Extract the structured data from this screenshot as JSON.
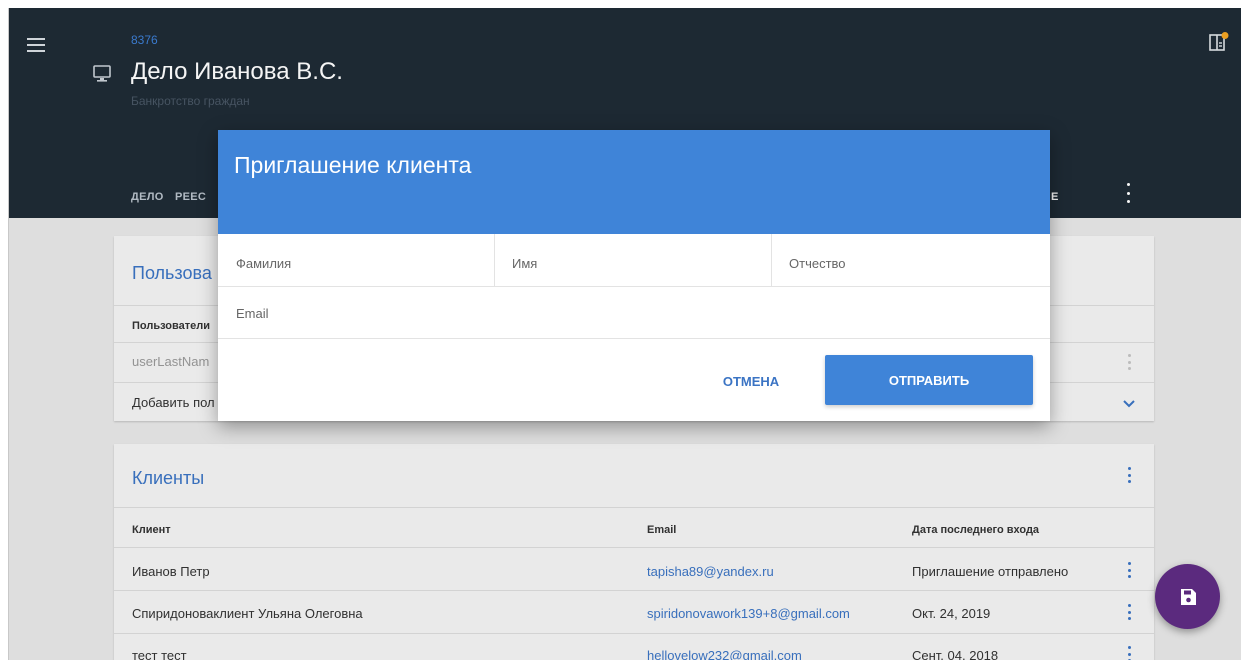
{
  "header": {
    "case_number": "8376",
    "title": "Дело Иванова В.С.",
    "subtitle": "Банкротство граждан",
    "tabs": [
      {
        "label": "ДЕЛО"
      },
      {
        "label": "РЕЕС"
      },
      {
        "label": "Е"
      }
    ]
  },
  "users_card": {
    "title": "Пользова",
    "column_header": "Пользователи",
    "row_value": "userLastNam",
    "add_row": "Добавить пол"
  },
  "clients_card": {
    "title": "Клиенты",
    "columns": [
      "Клиент",
      "Email",
      "Дата последнего входа"
    ],
    "rows": [
      {
        "name": "Иванов Петр",
        "email": "tapisha89@yandex.ru",
        "date": "Приглашение отправлено"
      },
      {
        "name": "Спиридоноваклиент Ульяна Олеговна",
        "email": "spiridonovawork139+8@gmail.com",
        "date": "Окт. 24, 2019"
      },
      {
        "name": "тест тест",
        "email": "hellovelow232@gmail.com",
        "date": "Сент. 04, 2018"
      }
    ]
  },
  "dialog": {
    "title": "Приглашение клиента",
    "fields": {
      "last_name": "Фамилия",
      "first_name": "Имя",
      "middle_name": "Отчество",
      "email": "Email"
    },
    "cancel_label": "ОТМЕНА",
    "send_label": "ОТПРАВИТЬ"
  },
  "colors": {
    "header_bg": "#1f2b36",
    "accent": "#3f84d8",
    "fab": "#5b2a7e",
    "badge": "#f5a623"
  },
  "icons": {
    "menu": "hamburger-menu-icon",
    "case": "monitor-icon",
    "corner": "notification-panel-icon",
    "fab": "save-icon"
  }
}
